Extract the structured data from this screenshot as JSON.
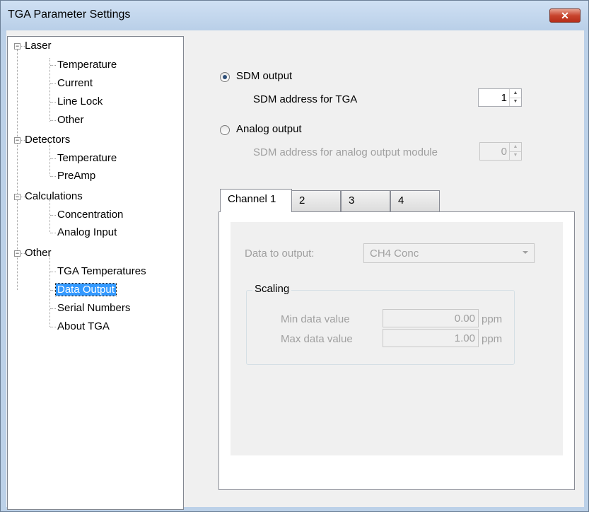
{
  "window": {
    "title": "TGA Parameter Settings",
    "close_label": "✕"
  },
  "tree": {
    "nodes": [
      {
        "label": "Laser",
        "expander": "−"
      },
      {
        "label": "Temperature"
      },
      {
        "label": "Current"
      },
      {
        "label": "Line Lock"
      },
      {
        "label": "Other"
      },
      {
        "label": "Detectors",
        "expander": "−"
      },
      {
        "label": "Temperature"
      },
      {
        "label": "PreAmp"
      },
      {
        "label": "Calculations",
        "expander": "−"
      },
      {
        "label": "Concentration"
      },
      {
        "label": "Analog Input"
      },
      {
        "label": "Other",
        "expander": "−"
      },
      {
        "label": "TGA Temperatures"
      },
      {
        "label": "Data Output"
      },
      {
        "label": "Serial Numbers"
      },
      {
        "label": "About TGA"
      }
    ],
    "selected": "Data Output"
  },
  "output": {
    "sdm_label": "SDM output",
    "sdm_selected": true,
    "sdm_address_label": "SDM address for TGA",
    "sdm_address_value": "1",
    "analog_label": "Analog output",
    "analog_selected": false,
    "analog_address_label": "SDM address for analog output module",
    "analog_address_value": "0"
  },
  "tabs": [
    "Channel 1",
    "2",
    "3",
    "4"
  ],
  "active_tab": "Channel 1",
  "channel": {
    "data_to_output_label": "Data to output:",
    "data_to_output_value": "CH4 Conc",
    "scaling_title": "Scaling",
    "min_label": "Min data value",
    "min_value": "0.00",
    "max_label": "Max data value",
    "max_value": "1.00",
    "unit": "ppm"
  },
  "icons": {
    "spin_up": "▲",
    "spin_down": "▼"
  },
  "colors": {
    "selection": "#3399ff",
    "close_button": "#c8452e",
    "title_bar": "#bcd1e8"
  }
}
